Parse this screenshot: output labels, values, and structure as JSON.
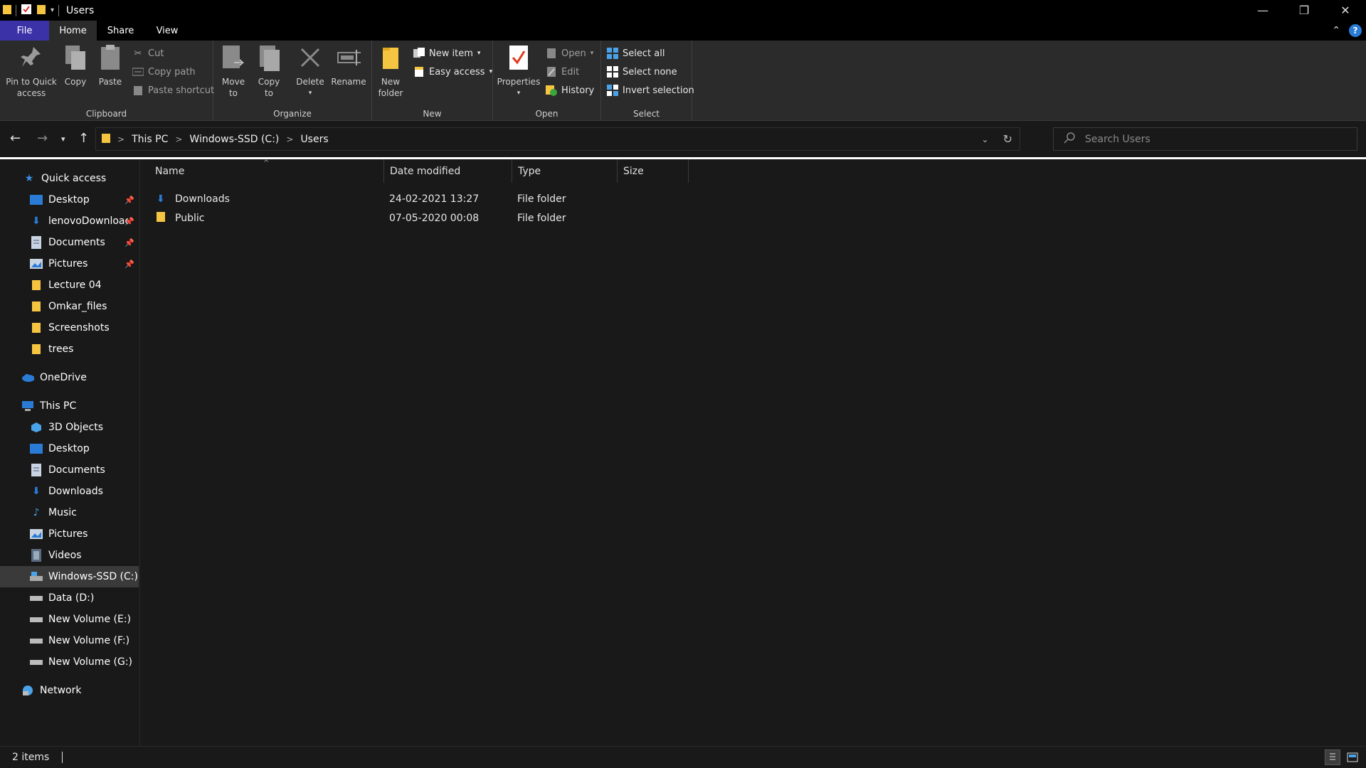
{
  "window": {
    "title": "Users",
    "controls": {
      "minimize": "—",
      "maximize": "❐",
      "close": "✕"
    }
  },
  "tabs": [
    {
      "label": "File"
    },
    {
      "label": "Home"
    },
    {
      "label": "Share"
    },
    {
      "label": "View"
    }
  ],
  "ribbon": {
    "clipboard": {
      "label": "Clipboard",
      "pin_line1": "Pin to Quick",
      "pin_line2": "access",
      "copy": "Copy",
      "paste": "Paste",
      "cut": "Cut",
      "copy_path": "Copy path",
      "paste_shortcut": "Paste shortcut"
    },
    "organize": {
      "label": "Organize",
      "move_line1": "Move",
      "move_line2": "to",
      "copyto_line1": "Copy",
      "copyto_line2": "to",
      "delete": "Delete",
      "rename": "Rename"
    },
    "new": {
      "label": "New",
      "new_folder_line1": "New",
      "new_folder_line2": "folder",
      "new_item": "New item",
      "easy_access": "Easy access"
    },
    "open": {
      "label": "Open",
      "properties": "Properties",
      "open": "Open",
      "edit": "Edit",
      "history": "History"
    },
    "select": {
      "label": "Select",
      "select_all": "Select all",
      "select_none": "Select none",
      "invert_selection": "Invert selection"
    }
  },
  "address": {
    "crumbs": [
      "This PC",
      "Windows-SSD (C:)",
      "Users"
    ],
    "search_placeholder": "Search Users"
  },
  "navpane": {
    "quick_access": "Quick access",
    "quick_items": [
      {
        "label": "Desktop",
        "pinned": true
      },
      {
        "label": "lenovoDownloac",
        "pinned": true
      },
      {
        "label": "Documents",
        "pinned": true
      },
      {
        "label": "Pictures",
        "pinned": true
      },
      {
        "label": "Lecture 04"
      },
      {
        "label": "Omkar_files"
      },
      {
        "label": "Screenshots"
      },
      {
        "label": "trees"
      }
    ],
    "onedrive": "OneDrive",
    "this_pc": "This PC",
    "pc_items": [
      {
        "label": "3D Objects"
      },
      {
        "label": "Desktop"
      },
      {
        "label": "Documents"
      },
      {
        "label": "Downloads"
      },
      {
        "label": "Music"
      },
      {
        "label": "Pictures"
      },
      {
        "label": "Videos"
      },
      {
        "label": "Windows-SSD (C:)",
        "selected": true
      },
      {
        "label": "Data (D:)"
      },
      {
        "label": "New Volume (E:)"
      },
      {
        "label": "New Volume (F:)"
      },
      {
        "label": "New Volume (G:)"
      }
    ],
    "network": "Network"
  },
  "filelist": {
    "columns": [
      "Name",
      "Date modified",
      "Type",
      "Size"
    ],
    "rows": [
      {
        "name": "Downloads",
        "date": "24-02-2021 13:27",
        "type": "File folder",
        "size": ""
      },
      {
        "name": "Public",
        "date": "07-05-2020 00:08",
        "type": "File folder",
        "size": ""
      }
    ]
  },
  "status": {
    "item_count": "2 items"
  },
  "colors": {
    "accent": "#3c32a8",
    "folder": "#f5c542",
    "blue": "#2a7bd6"
  }
}
